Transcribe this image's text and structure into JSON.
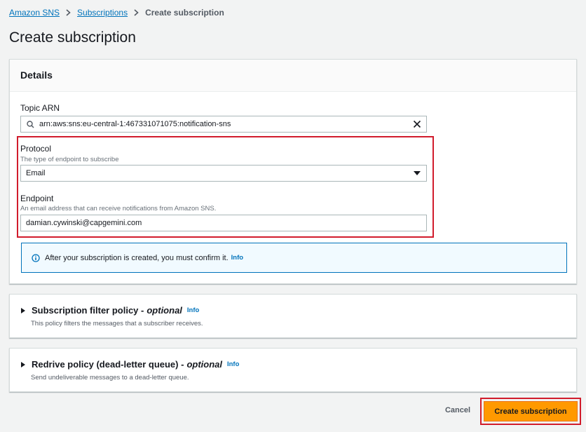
{
  "breadcrumb": {
    "items": [
      "Amazon SNS",
      "Subscriptions"
    ],
    "current": "Create subscription"
  },
  "page_title": "Create subscription",
  "details": {
    "title": "Details",
    "topic_arn": {
      "label": "Topic ARN",
      "value": "arn:aws:sns:eu-central-1:467331071075:notification-sns"
    },
    "protocol": {
      "label": "Protocol",
      "description": "The type of endpoint to subscribe",
      "value": "Email"
    },
    "endpoint": {
      "label": "Endpoint",
      "description": "An email address that can receive notifications from Amazon SNS.",
      "value": "damian.cywinski@capgemini.com"
    },
    "info_message": "After your subscription is created, you must confirm it.",
    "info_link": "Info"
  },
  "filter_policy": {
    "title": "Subscription filter policy -",
    "optional": "optional",
    "info": "Info",
    "description": "This policy filters the messages that a subscriber receives."
  },
  "redrive_policy": {
    "title": "Redrive policy (dead-letter queue) -",
    "optional": "optional",
    "info": "Info",
    "description": "Send undeliverable messages to a dead-letter queue."
  },
  "actions": {
    "cancel": "Cancel",
    "create": "Create subscription"
  },
  "colors": {
    "link": "#0073bb",
    "primary_button": "#ff9900",
    "highlight": "#d11c2c",
    "background": "#f2f3f3"
  }
}
